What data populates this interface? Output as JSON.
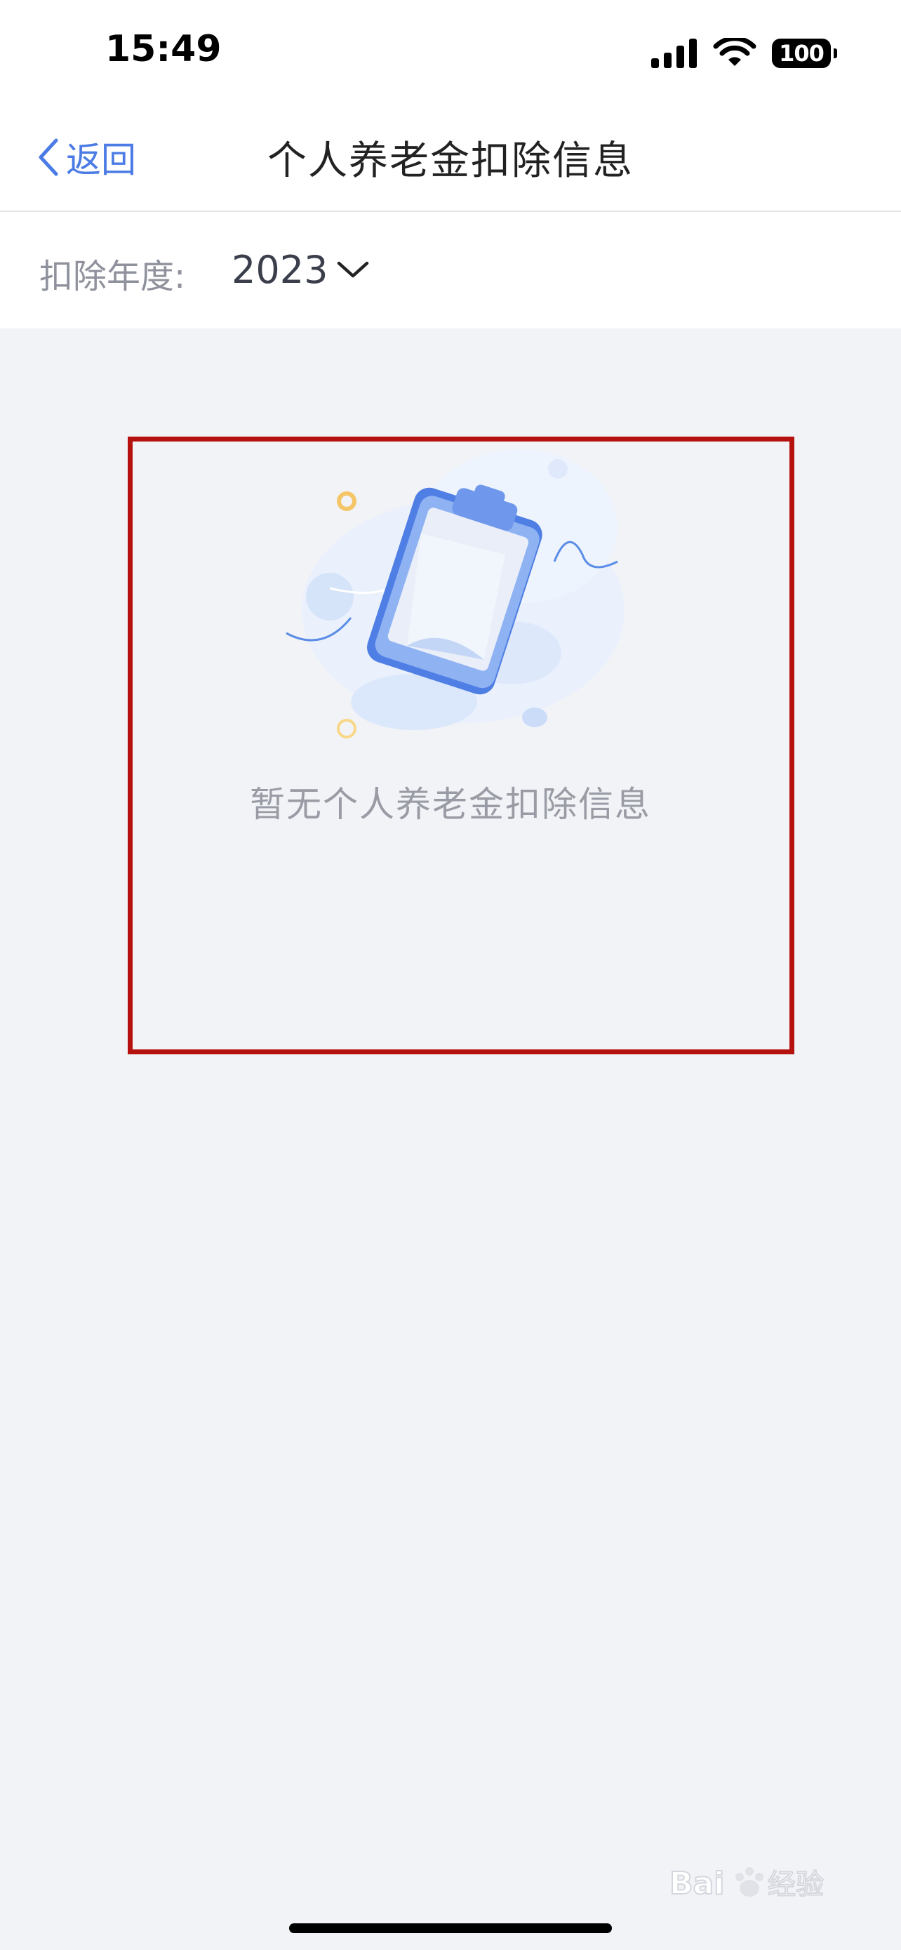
{
  "status_bar": {
    "time": "15:49",
    "battery": "100",
    "icons": [
      "signal-icon",
      "wifi-icon",
      "battery-icon"
    ]
  },
  "nav": {
    "back_label": "返回",
    "title": "个人养老金扣除信息",
    "back_icon": "chevron-left-icon"
  },
  "filter": {
    "label": "扣除年度:",
    "year": "2023",
    "dropdown_icon": "chevron-down-icon"
  },
  "empty_state": {
    "icon": "clipboard-illustration",
    "message": "暂无个人养老金扣除信息"
  },
  "colors": {
    "accent": "#4b7be5",
    "background": "#f2f3f7",
    "highlight": "#b5120f"
  }
}
